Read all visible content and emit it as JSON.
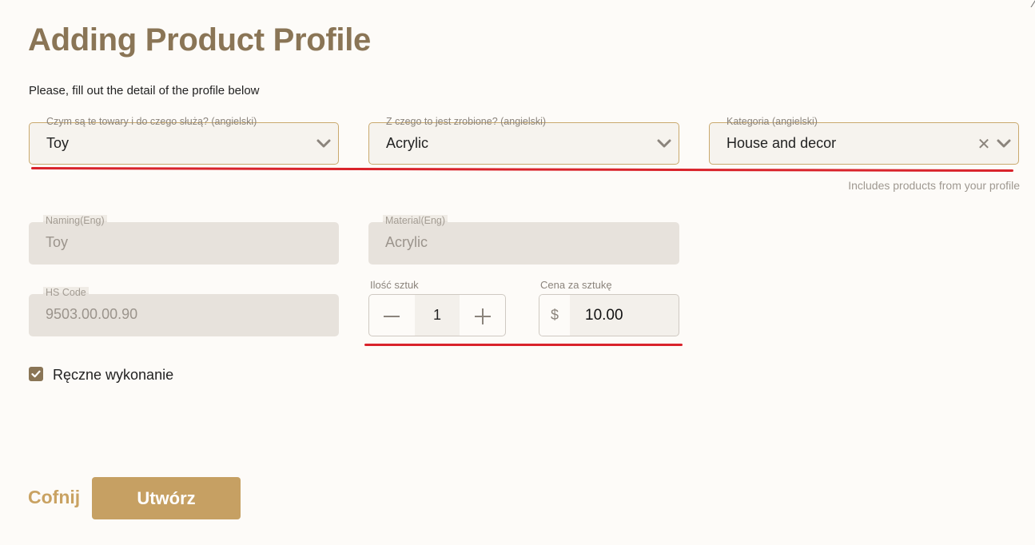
{
  "dialog": {
    "title": "Adding Product Profile",
    "subtitle": "Please, fill out the detail of the profile below"
  },
  "selects": {
    "purpose": {
      "label": "Czym są te towary i do czego służą? (angielski)",
      "value": "Toy"
    },
    "material": {
      "label": "Z czego to jest zrobione? (angielski)",
      "value": "Acrylic"
    },
    "category": {
      "label": "Kategoria (angielski)",
      "value": "House and decor",
      "hint": "Includes products from your profile"
    }
  },
  "readonly": {
    "naming": {
      "label": "Naming(Eng)",
      "value": "Toy"
    },
    "material": {
      "label": "Material(Eng)",
      "value": "Acrylic"
    },
    "hs_code": {
      "label": "HS Code",
      "value": "9503.00.00.90"
    }
  },
  "quantity": {
    "label": "Ilość sztuk",
    "value": "1"
  },
  "price": {
    "label": "Cena za sztukę",
    "currency": "$",
    "value": "10.00"
  },
  "handmade": {
    "label": "Ręczne wykonanie",
    "checked": true
  },
  "actions": {
    "back": "Cofnij",
    "create": "Utwórz"
  },
  "icons": {
    "dropdown": "chevron-down-icon",
    "clear": "close-icon",
    "minus": "minus-icon",
    "plus": "plus-icon",
    "check": "checkmark-icon"
  },
  "colors": {
    "title": "#8a7556",
    "accent": "#c6a063",
    "field_border": "#c9a96e",
    "annotation": "#d9232b"
  }
}
